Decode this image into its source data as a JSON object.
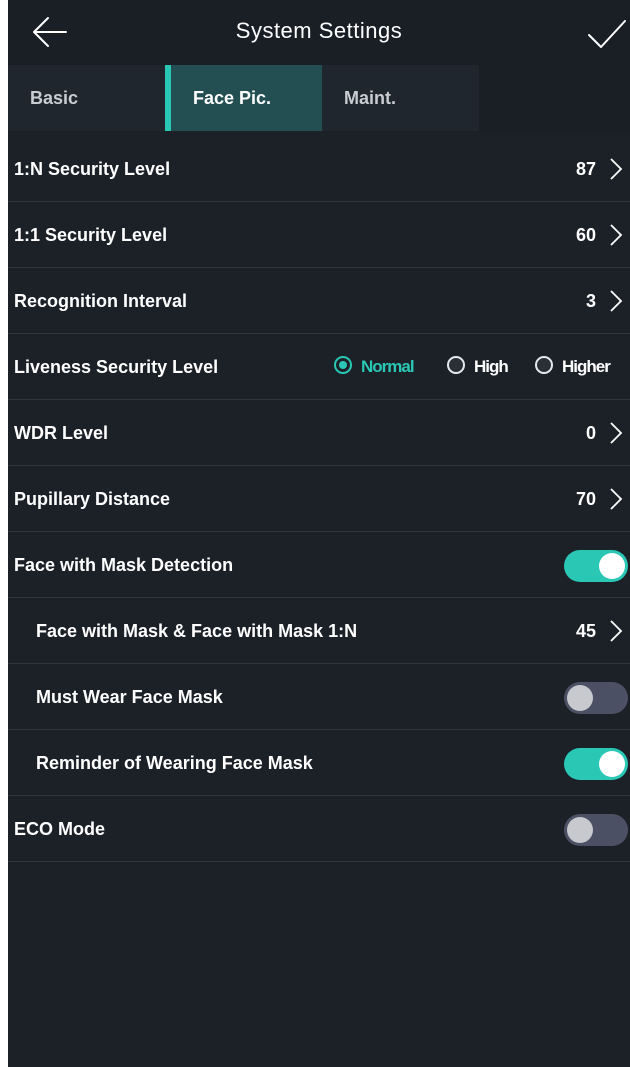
{
  "header": {
    "title": "System Settings",
    "back_icon": "arrow-left-icon",
    "confirm_icon": "checkmark-icon"
  },
  "tabs": [
    {
      "label": "Basic",
      "active": false
    },
    {
      "label": "Face Pic.",
      "active": true
    },
    {
      "label": "Maint.",
      "active": false
    }
  ],
  "settings": {
    "n_security_level": {
      "label": "1:N Security Level",
      "value": "87"
    },
    "one_one_security_level": {
      "label": "1:1 Security Level",
      "value": "60"
    },
    "recognition_interval": {
      "label": "Recognition Interval",
      "value": "3"
    },
    "liveness_security_level": {
      "label": "Liveness Security Level",
      "options": [
        "Normal",
        "High",
        "Higher"
      ],
      "selected": "Normal"
    },
    "wdr_level": {
      "label": "WDR Level",
      "value": "0"
    },
    "pupillary_distance": {
      "label": "Pupillary Distance",
      "value": "70"
    },
    "face_with_mask_detection": {
      "label": "Face with Mask Detection",
      "enabled": true
    },
    "face_with_mask_1n": {
      "label": "Face with Mask & Face with Mask 1:N",
      "value": "45"
    },
    "must_wear_face_mask": {
      "label": "Must Wear Face Mask",
      "enabled": false
    },
    "reminder_wearing_face_mask": {
      "label": "Reminder of Wearing Face Mask",
      "enabled": true
    },
    "eco_mode": {
      "label": "ECO Mode",
      "enabled": false
    }
  },
  "colors": {
    "accent": "#2ac7b5",
    "background": "#1c2128",
    "toggle_off": "#4c5064"
  }
}
